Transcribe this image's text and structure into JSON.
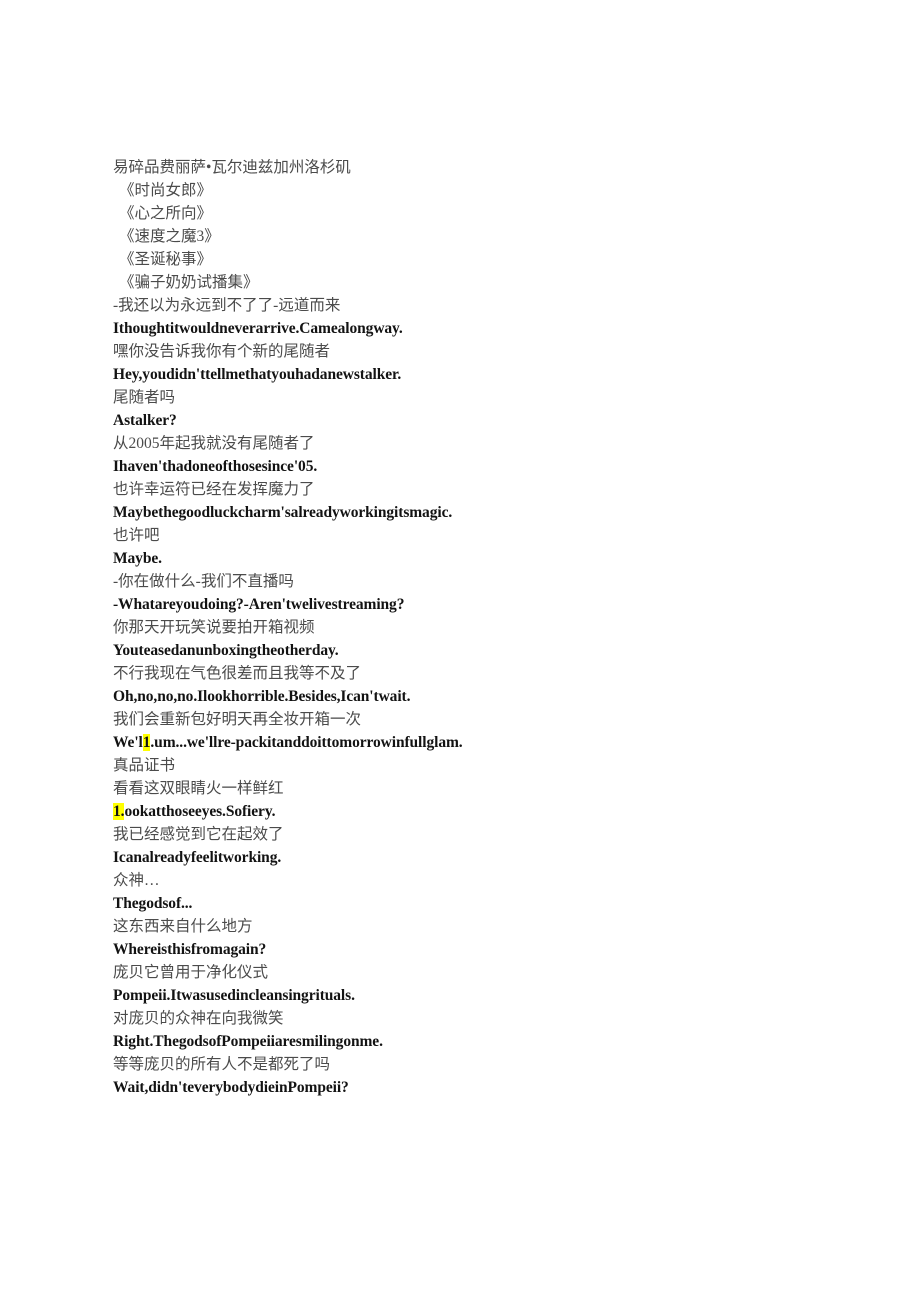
{
  "document": {
    "type": "bilingual-subtitle-transcript",
    "background_color": "#ffffff",
    "text_color_source": "#4b4b4b",
    "text_color_target": "#131313",
    "highlight_color": "#ffff00"
  },
  "lines": [
    {
      "lang": "zh",
      "indent": false,
      "text": "易碎品费丽萨•瓦尔迪兹加州洛杉矶"
    },
    {
      "lang": "zh",
      "indent": true,
      "text": "《时尚女郎》"
    },
    {
      "lang": "zh",
      "indent": true,
      "text": "《心之所向》"
    },
    {
      "lang": "zh",
      "indent": true,
      "text": "《速度之魔3》"
    },
    {
      "lang": "zh",
      "indent": true,
      "text": "《圣诞秘事》"
    },
    {
      "lang": "zh",
      "indent": true,
      "text": "《骗子奶奶试播集》"
    },
    {
      "lang": "zh",
      "indent": false,
      "text": "-我还以为永远到不了了-远道而来"
    },
    {
      "lang": "en",
      "indent": false,
      "text": "Ithoughtitwouldneverarrive.Camealongway."
    },
    {
      "lang": "zh",
      "indent": false,
      "text": "嘿你没告诉我你有个新的尾随者"
    },
    {
      "lang": "en",
      "indent": false,
      "text": "Hey,youdidn'ttellmethatyouhadanewstalker."
    },
    {
      "lang": "zh",
      "indent": false,
      "text": "尾随者吗"
    },
    {
      "lang": "en",
      "indent": false,
      "text": "Astalker?"
    },
    {
      "lang": "zh",
      "indent": false,
      "text": "从2005年起我就没有尾随者了"
    },
    {
      "lang": "en",
      "indent": false,
      "text": "Ihaven'thadoneofthosesince'05."
    },
    {
      "lang": "zh",
      "indent": false,
      "text": "也许幸运符已经在发挥魔力了"
    },
    {
      "lang": "en",
      "indent": false,
      "text": "Maybethegoodluckcharm'salreadyworkingitsmagic."
    },
    {
      "lang": "zh",
      "indent": false,
      "text": "也许吧"
    },
    {
      "lang": "en",
      "indent": false,
      "text": "Maybe."
    },
    {
      "lang": "zh",
      "indent": false,
      "text": "-你在做什么-我们不直播吗"
    },
    {
      "lang": "en",
      "indent": false,
      "text": "-Whatareyoudoing?-Aren'twelivestreaming?"
    },
    {
      "lang": "zh",
      "indent": false,
      "text": "你那天开玩笑说要拍开箱视频"
    },
    {
      "lang": "en",
      "indent": false,
      "text": "Youteasedanunboxingtheotherday."
    },
    {
      "lang": "zh",
      "indent": false,
      "text": "不行我现在气色很差而且我等不及了"
    },
    {
      "lang": "en",
      "indent": false,
      "text": "Oh,no,no,no.Ilookhorrible.Besides,Ican'twait."
    },
    {
      "lang": "zh",
      "indent": false,
      "text": "我们会重新包好明天再全妆开箱一次"
    },
    {
      "lang": "en",
      "indent": false,
      "segments": [
        {
          "text": "We'l",
          "highlight": false
        },
        {
          "text": "1",
          "highlight": true
        },
        {
          "text": ".um...we'llre-packitanddoittomorrowinfullglam.",
          "highlight": false
        }
      ]
    },
    {
      "lang": "zh",
      "indent": false,
      "text": "真品证书"
    },
    {
      "lang": "zh",
      "indent": false,
      "text": "看看这双眼睛火一样鲜红"
    },
    {
      "lang": "en",
      "indent": false,
      "segments": [
        {
          "text": "1.",
          "highlight": true
        },
        {
          "text": "ookatthoseeyes.Sofiery.",
          "highlight": false
        }
      ]
    },
    {
      "lang": "zh",
      "indent": false,
      "text": "我已经感觉到它在起效了"
    },
    {
      "lang": "en",
      "indent": false,
      "text": "Icanalreadyfeelitworking."
    },
    {
      "lang": "zh",
      "indent": false,
      "text": "众神…"
    },
    {
      "lang": "en",
      "indent": false,
      "text": "Thegodsof..."
    },
    {
      "lang": "zh",
      "indent": false,
      "text": "这东西来自什么地方"
    },
    {
      "lang": "en",
      "indent": false,
      "text": "Whereisthisfromagain?"
    },
    {
      "lang": "zh",
      "indent": false,
      "text": "庞贝它曾用于净化仪式"
    },
    {
      "lang": "en",
      "indent": false,
      "text": "Pompeii.Itwasusedincleansingrituals."
    },
    {
      "lang": "zh",
      "indent": false,
      "text": "对庞贝的众神在向我微笑"
    },
    {
      "lang": "en",
      "indent": false,
      "text": "Right.ThegodsofPompeiiaresmilingonme."
    },
    {
      "lang": "zh",
      "indent": false,
      "text": "等等庞贝的所有人不是都死了吗"
    },
    {
      "lang": "en",
      "indent": false,
      "text": "Wait,didn'teverybodydieinPompeii?"
    }
  ]
}
